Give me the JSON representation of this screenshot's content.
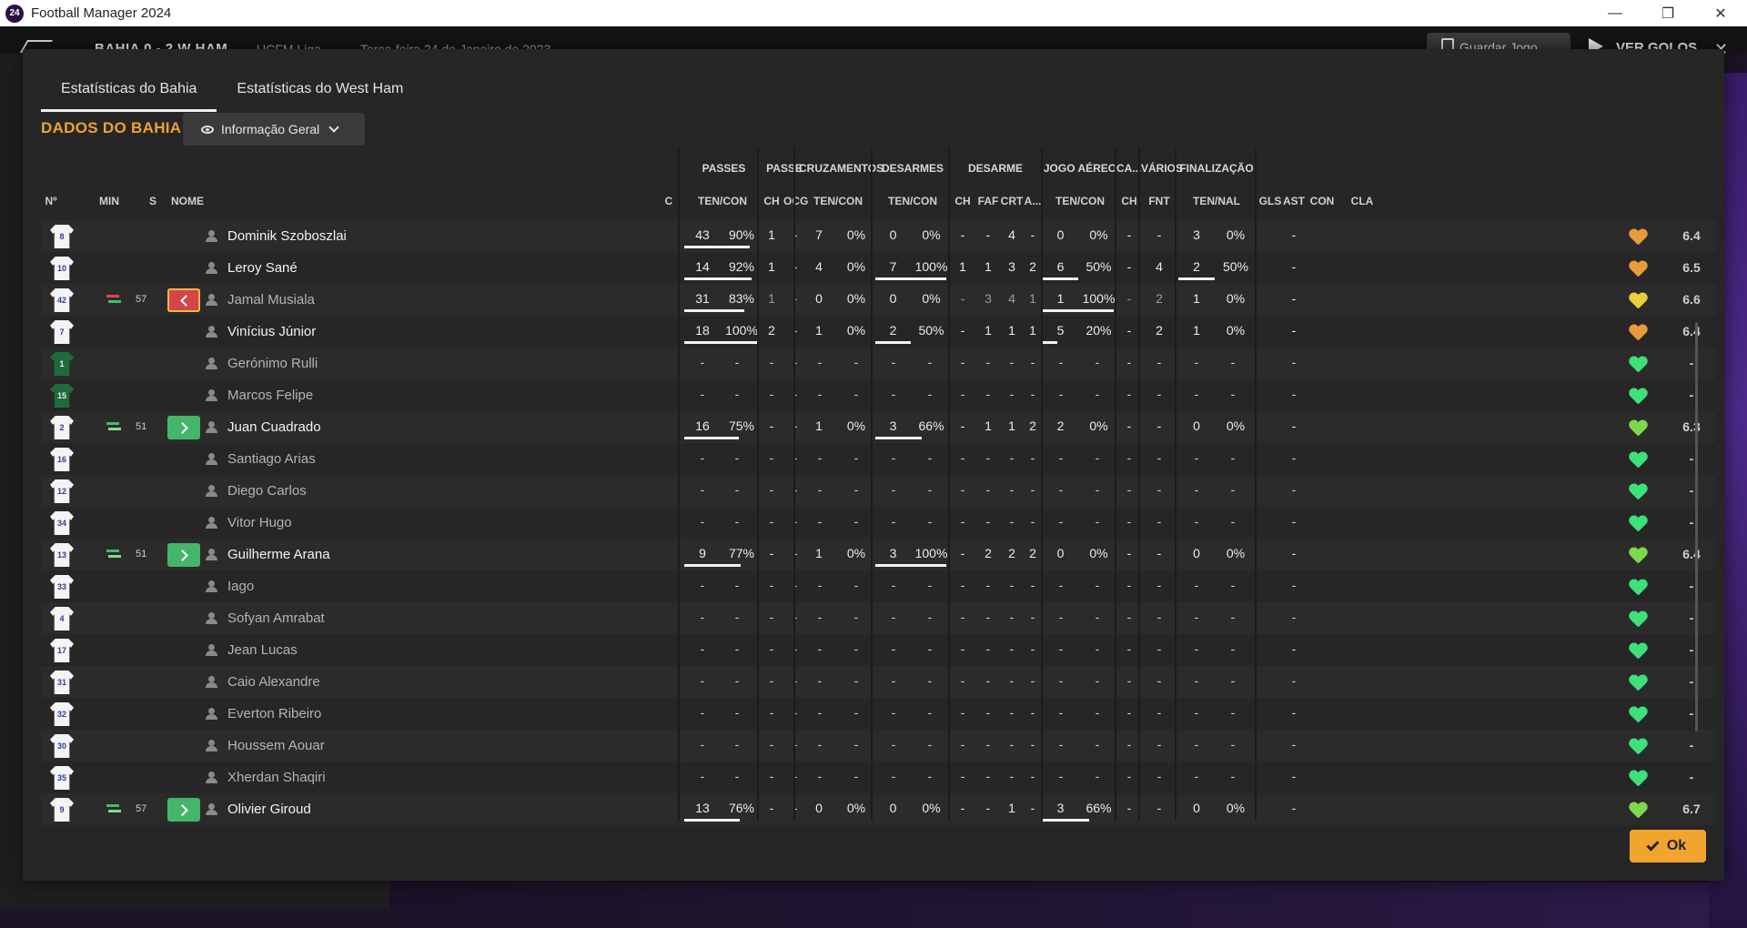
{
  "window": {
    "title": "Football Manager 2024",
    "logo_text": "24"
  },
  "background": {
    "score": "BAHIA  0 - 2  W HAM",
    "league": "UCFM Liga",
    "date": "Terça-feira 24 de Janeiro de 2023",
    "save_label": "Guardar Jogo",
    "goals_label": "VER GOLOS"
  },
  "modal": {
    "tabs": [
      {
        "label": "Estatísticas do Bahia",
        "active": true
      },
      {
        "label": "Estatísticas do West Ham",
        "active": false
      }
    ],
    "section_title": "DADOS DO BAHIA",
    "view_select": "Informação Geral",
    "ok_label": "Ok"
  },
  "table": {
    "groups": [
      "PASSES",
      "PASSE",
      "CRUZAMENTOS",
      "DESARMES",
      "DESARME",
      "JOGO AÉREO",
      "CA...",
      "VÁRIOS",
      "FINALIZAÇÃO"
    ],
    "columns": [
      "Nº",
      "MIN",
      "S",
      "NOME",
      "C",
      "TEN/CON",
      "CH",
      "OCG",
      "TEN/CON",
      "TEN/CON",
      "CH",
      "FAF",
      "CRT",
      "A...",
      "TEN/CON",
      "CH",
      "FNT",
      "TEN/NAL",
      "GLS",
      "AST",
      "CON",
      "CLA"
    ],
    "rows": [
      {
        "num": "8",
        "gk": false,
        "sub": "",
        "min": "",
        "name": "Dominik Szoboszlai",
        "played": true,
        "pass_t": "43",
        "pass_p": "90%",
        "pass_pct": 90,
        "ch": "1",
        "ocg": "-",
        "cru_t": "7",
        "cru_p": "0%",
        "cru_pct": 0,
        "des_t": "0",
        "des_p": "0%",
        "des_pct": 0,
        "d_ch": "-",
        "faf": "-",
        "crt": "4",
        "a": "-",
        "aer_t": "0",
        "aer_p": "0%",
        "aer_pct": 0,
        "ca_ch": "-",
        "fnt": "-",
        "fin_t": "3",
        "fin_p": "0%",
        "fin_pct": 0,
        "gls": "",
        "ast": "-",
        "con_color": "#e89a3c",
        "cla": "6.4"
      },
      {
        "num": "10",
        "gk": false,
        "sub": "",
        "min": "",
        "name": "Leroy Sané",
        "played": true,
        "pass_t": "14",
        "pass_p": "92%",
        "pass_pct": 92,
        "ch": "1",
        "ocg": "-",
        "cru_t": "4",
        "cru_p": "0%",
        "cru_pct": 0,
        "des_t": "7",
        "des_p": "100%",
        "des_pct": 100,
        "d_ch": "1",
        "faf": "1",
        "crt": "3",
        "a": "2",
        "aer_t": "6",
        "aer_p": "50%",
        "aer_pct": 50,
        "ca_ch": "-",
        "fnt": "4",
        "fin_t": "2",
        "fin_p": "50%",
        "fin_pct": 50,
        "gls": "",
        "ast": "-",
        "con_color": "#e89a3c",
        "cla": "6.5"
      },
      {
        "num": "42",
        "gk": false,
        "sub": "out",
        "min": "57",
        "name": "Jamal Musiala",
        "played": false,
        "pass_t": "31",
        "pass_p": "83%",
        "pass_pct": 83,
        "ch": "1",
        "ocg": "-",
        "cru_t": "0",
        "cru_p": "0%",
        "cru_pct": 0,
        "des_t": "0",
        "des_p": "0%",
        "des_pct": 0,
        "d_ch": "-",
        "faf": "3",
        "crt": "4",
        "a": "1",
        "aer_t": "1",
        "aer_p": "100%",
        "aer_pct": 100,
        "ca_ch": "-",
        "fnt": "2",
        "fin_t": "1",
        "fin_p": "0%",
        "fin_pct": 0,
        "gls": "",
        "ast": "-",
        "con_color": "#e8cf3c",
        "cla": "6.6"
      },
      {
        "num": "7",
        "gk": false,
        "sub": "",
        "min": "",
        "name": "Vinícius Júnior",
        "played": true,
        "pass_t": "18",
        "pass_p": "100%",
        "pass_pct": 100,
        "ch": "2",
        "ocg": "-",
        "cru_t": "1",
        "cru_p": "0%",
        "cru_pct": 0,
        "des_t": "2",
        "des_p": "50%",
        "des_pct": 50,
        "d_ch": "-",
        "faf": "1",
        "crt": "1",
        "a": "1",
        "aer_t": "5",
        "aer_p": "20%",
        "aer_pct": 20,
        "ca_ch": "-",
        "fnt": "2",
        "fin_t": "1",
        "fin_p": "0%",
        "fin_pct": 0,
        "gls": "",
        "ast": "-",
        "con_color": "#e89a3c",
        "cla": "6.4"
      },
      {
        "num": "1",
        "gk": true,
        "sub": "",
        "min": "",
        "name": "Gerónimo Rulli",
        "played": false,
        "empty": true,
        "con_color": "#3ee07a",
        "cla": "-"
      },
      {
        "num": "15",
        "gk": true,
        "sub": "",
        "min": "",
        "name": "Marcos Felipe",
        "played": false,
        "empty": true,
        "con_color": "#3ee07a",
        "cla": "-"
      },
      {
        "num": "2",
        "gk": false,
        "sub": "in",
        "min": "51",
        "name": "Juan Cuadrado",
        "played": true,
        "pass_t": "16",
        "pass_p": "75%",
        "pass_pct": 75,
        "ch": "-",
        "ocg": "-",
        "cru_t": "1",
        "cru_p": "0%",
        "cru_pct": 0,
        "des_t": "3",
        "des_p": "66%",
        "des_pct": 66,
        "d_ch": "-",
        "faf": "1",
        "crt": "1",
        "a": "2",
        "aer_t": "2",
        "aer_p": "0%",
        "aer_pct": 0,
        "ca_ch": "-",
        "fnt": "-",
        "fin_t": "0",
        "fin_p": "0%",
        "fin_pct": 0,
        "gls": "",
        "ast": "-",
        "con_color": "#7ed94a",
        "cla": "6.3"
      },
      {
        "num": "16",
        "gk": false,
        "sub": "",
        "min": "",
        "name": "Santiago Arias",
        "played": false,
        "empty": true,
        "con_color": "#3ee07a",
        "cla": "-"
      },
      {
        "num": "12",
        "gk": false,
        "sub": "",
        "min": "",
        "name": "Diego Carlos",
        "played": false,
        "empty": true,
        "con_color": "#3ee07a",
        "cla": "-"
      },
      {
        "num": "34",
        "gk": false,
        "sub": "",
        "min": "",
        "name": "Vitor Hugo",
        "played": false,
        "empty": true,
        "con_color": "#3ee07a",
        "cla": "-"
      },
      {
        "num": "13",
        "gk": false,
        "sub": "in",
        "min": "51",
        "name": "Guilherme Arana",
        "played": true,
        "pass_t": "9",
        "pass_p": "77%",
        "pass_pct": 77,
        "ch": "-",
        "ocg": "-",
        "cru_t": "1",
        "cru_p": "0%",
        "cru_pct": 0,
        "des_t": "3",
        "des_p": "100%",
        "des_pct": 100,
        "d_ch": "-",
        "faf": "2",
        "crt": "2",
        "a": "2",
        "aer_t": "0",
        "aer_p": "0%",
        "aer_pct": 0,
        "ca_ch": "-",
        "fnt": "-",
        "fin_t": "0",
        "fin_p": "0%",
        "fin_pct": 0,
        "gls": "",
        "ast": "-",
        "con_color": "#7ed94a",
        "cla": "6.4"
      },
      {
        "num": "33",
        "gk": false,
        "sub": "",
        "min": "",
        "name": "Iago",
        "played": false,
        "empty": true,
        "con_color": "#3ee07a",
        "cla": "-"
      },
      {
        "num": "4",
        "gk": false,
        "sub": "",
        "min": "",
        "name": "Sofyan Amrabat",
        "played": false,
        "empty": true,
        "con_color": "#3ee07a",
        "cla": "-"
      },
      {
        "num": "17",
        "gk": false,
        "sub": "",
        "min": "",
        "name": "Jean Lucas",
        "played": false,
        "empty": true,
        "con_color": "#3ee07a",
        "cla": "-"
      },
      {
        "num": "31",
        "gk": false,
        "sub": "",
        "min": "",
        "name": "Caio Alexandre",
        "played": false,
        "empty": true,
        "con_color": "#3ee07a",
        "cla": "-"
      },
      {
        "num": "32",
        "gk": false,
        "sub": "",
        "min": "",
        "name": "Everton Ribeiro",
        "played": false,
        "empty": true,
        "con_color": "#3ee07a",
        "cla": "-"
      },
      {
        "num": "30",
        "gk": false,
        "sub": "",
        "min": "",
        "name": "Houssem Aouar",
        "played": false,
        "empty": true,
        "con_color": "#3ee07a",
        "cla": "-"
      },
      {
        "num": "35",
        "gk": false,
        "sub": "",
        "min": "",
        "name": "Xherdan Shaqiri",
        "played": false,
        "empty": true,
        "con_color": "#3ee07a",
        "cla": "-"
      },
      {
        "num": "9",
        "gk": false,
        "sub": "in",
        "min": "57",
        "name": "Olivier Giroud",
        "played": true,
        "pass_t": "13",
        "pass_p": "76%",
        "pass_pct": 76,
        "ch": "-",
        "ocg": "-",
        "cru_t": "0",
        "cru_p": "0%",
        "cru_pct": 0,
        "des_t": "0",
        "des_p": "0%",
        "des_pct": 0,
        "d_ch": "-",
        "faf": "-",
        "crt": "1",
        "a": "-",
        "aer_t": "3",
        "aer_p": "66%",
        "aer_pct": 66,
        "ca_ch": "-",
        "fnt": "-",
        "fin_t": "0",
        "fin_p": "0%",
        "fin_pct": 0,
        "gls": "",
        "ast": "-",
        "con_color": "#7ed94a",
        "cla": "6.7"
      }
    ]
  }
}
